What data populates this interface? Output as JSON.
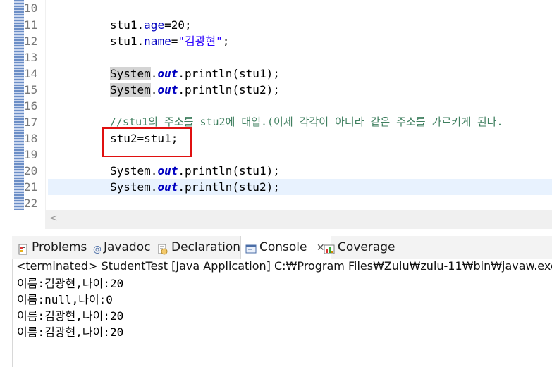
{
  "editor": {
    "lines": [
      {
        "num": "10",
        "code": ""
      },
      {
        "num": "11",
        "code": "stu1.age=20;"
      },
      {
        "num": "12",
        "code": "stu1.name=\"김광현\";"
      },
      {
        "num": "13",
        "code": ""
      },
      {
        "num": "14",
        "code": "System.out.println(stu1);"
      },
      {
        "num": "15",
        "code": "System.out.println(stu2);"
      },
      {
        "num": "16",
        "code": ""
      },
      {
        "num": "17",
        "code": "//stu1의 주소를 stu2에 대입.(이제 각각이 아니라 같은 주소를 가르키게 된다."
      },
      {
        "num": "18",
        "code": "stu2=stu1;"
      },
      {
        "num": "19",
        "code": ""
      },
      {
        "num": "20",
        "code": "System.out.println(stu1);"
      },
      {
        "num": "21",
        "code": "System.out.println(stu2);"
      },
      {
        "num": "22",
        "code": ""
      }
    ],
    "tokens": {
      "stu1": "stu1",
      "age": "age",
      "name": "name",
      "eq": "=",
      "dot": ".",
      "n20": "20;",
      "str_kim": "\"김광현\"",
      "semi": ";",
      "system": "System",
      "out": "out",
      "println1": ".println(stu1);",
      "println2": ".println(stu2);",
      "comment": "//stu1의 주소를 stu2에 대입.(이제 각각이 아니라 같은 주소를 가르키게 된다.",
      "assign": "stu2=stu1;"
    },
    "scroll_left": "<"
  },
  "panel": {
    "tabs": [
      {
        "label": "Problems",
        "icon": "problems-icon"
      },
      {
        "label": "Javadoc",
        "icon": "javadoc-icon"
      },
      {
        "label": "Declaration",
        "icon": "declaration-icon"
      },
      {
        "label": "Console",
        "icon": "console-icon",
        "close": "✕"
      },
      {
        "label": "Coverage",
        "icon": "coverage-icon"
      }
    ],
    "status": "<terminated> StudentTest [Java Application] C:₩Program Files₩Zulu₩zulu-11₩bin₩javaw.exe",
    "output": [
      "이름:김광현,나이:20",
      "이름:null,나이:0",
      "이름:김광현,나이:20",
      "이름:김광현,나이:20"
    ]
  }
}
